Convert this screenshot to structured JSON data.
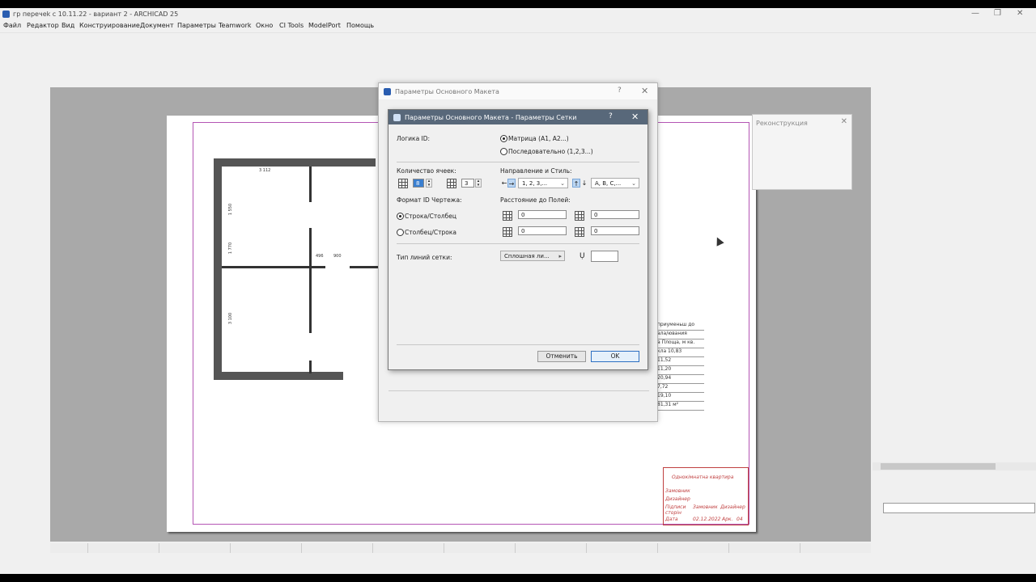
{
  "window": {
    "title": "гр перечеk с 10.11.22 - вариант 2 - ARCHICAD 25",
    "minimize": "—",
    "restore": "❐",
    "close": "✕"
  },
  "menu": [
    "Файл",
    "Редактор",
    "Вид",
    "Конструирование",
    "Документ",
    "Параметры",
    "Teamwork",
    "Окно",
    "CI Tools",
    "ModelPort",
    "Помощь"
  ],
  "outer_dialog": {
    "title": "Параметры Основного Макета",
    "help": "?",
    "close": "✕"
  },
  "recon_panel": {
    "title": "Реконструкция",
    "close": "✕"
  },
  "dialog": {
    "title": "Параметры Основного Макета - Параметры Сетки",
    "help": "?",
    "close": "✕",
    "id_logic_label": "Логика ID:",
    "id_logic_options": [
      "Матрица (A1, A2...)",
      "Последовательно (1,2,3...)"
    ],
    "id_logic_selected": "Матрица (A1, A2...)",
    "cells_label": "Количество ячеек:",
    "cells_cols": "8",
    "cells_rows": "3",
    "direction_label": "Направление и Стиль:",
    "dir_h_left": "←",
    "dir_h_right": "→",
    "dir_v_up": "↑",
    "dir_v_down": "↓",
    "numbering_style": "1, 2, 3,...",
    "letter_style": "A, B, C,...",
    "format_label": "Формат ID Чертежа:",
    "format_options": [
      "Строка/Столбец",
      "Столбец/Строка"
    ],
    "format_selected": "Строка/Столбец",
    "margins_label": "Расстояние до Полей:",
    "margin_top": "0",
    "margin_right": "0",
    "margin_bottom": "0",
    "margin_left": "0",
    "line_type_label": "Тип линий сетки:",
    "line_type_value": "Сплошная ли...",
    "line_type_arrow": "▸",
    "pen_icon": "Ụ",
    "cancel": "Отменить",
    "ok": "OK"
  },
  "drawing": {
    "plan_labels": [
      "3 112",
      "1 550",
      "1 770",
      "496",
      "900",
      "3 100"
    ],
    "table_rows": [
      "приуменьш до",
      "ала/ювания",
      "а    Площа, м кв.",
      "кла   10,83",
      "11,52",
      "11,20",
      "20,94",
      "7,72",
      "19,10",
      "81,31 м²"
    ],
    "stamp": {
      "title": "Однокімнатна квартира",
      "zamovnyk": "Замовник",
      "dyzainer": "Дизайнер",
      "pidpysy": "Підписи сторін",
      "zamovnyk2": "Замовник",
      "dyzainer2": "Дизайнер",
      "data": "Дата",
      "date": "02.12.2022",
      "ark": "Арк.",
      "num": "04"
    }
  },
  "colors": {
    "dialog_header": "#58687a",
    "frame": "#b455b4",
    "stamp": "#c04040",
    "workspace": "#a9a9a9"
  }
}
